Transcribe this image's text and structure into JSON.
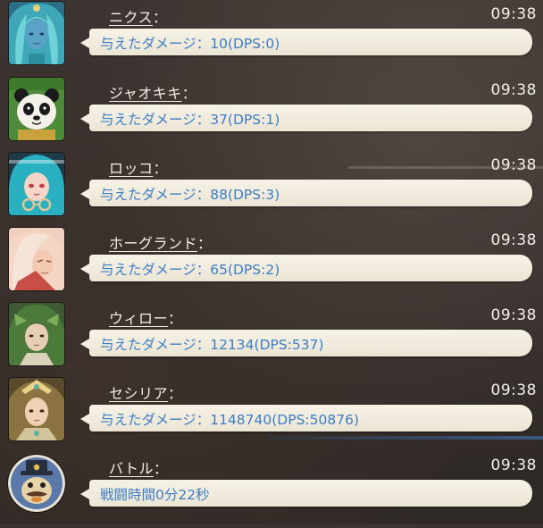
{
  "messages": [
    {
      "name": "ニクス",
      "colon": "：",
      "time": "09:38",
      "text": "与えたダメージ：10(DPS:0)",
      "avatar_icon": "nyx-portrait"
    },
    {
      "name": "ジャオキキ",
      "colon": "：",
      "time": "09:38",
      "text": "与えたダメージ：37(DPS:1)",
      "avatar_icon": "panda-portrait"
    },
    {
      "name": "ロッコ",
      "colon": "：",
      "time": "09:38",
      "text": "与えたダメージ：88(DPS:3)",
      "avatar_icon": "rocco-portrait"
    },
    {
      "name": "ホーグランド",
      "colon": "：",
      "time": "09:38",
      "text": "与えたダメージ：65(DPS:2)",
      "avatar_icon": "hoagland-portrait"
    },
    {
      "name": "ウィロー",
      "colon": "：",
      "time": "09:38",
      "text": "与えたダメージ：12134(DPS:537)",
      "avatar_icon": "willow-portrait"
    },
    {
      "name": "セシリア",
      "colon": "：",
      "time": "09:38",
      "text": "与えたダメージ：1148740(DPS:50876)",
      "avatar_icon": "cecilia-portrait"
    },
    {
      "name": "バトル",
      "colon": "：",
      "time": "09:38",
      "text": "戦闘時間0分22秒",
      "avatar_icon": "battle-mascot-icon"
    }
  ],
  "colors": {
    "bubble_text": "#3d7ec4",
    "name_text": "#f2efe9",
    "bubble_bg": "#f6f2e6"
  }
}
